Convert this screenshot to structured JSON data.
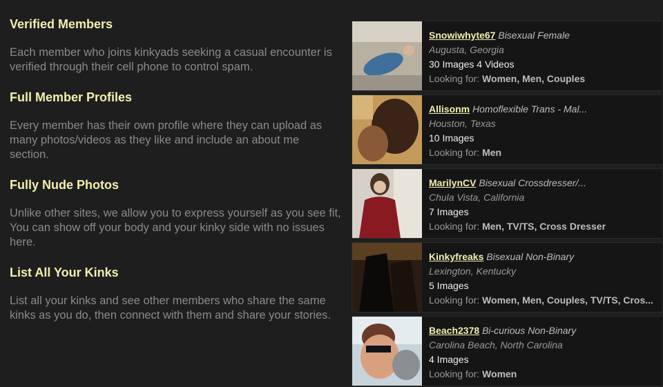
{
  "features": [
    {
      "title": "Verified Members",
      "text": "Each member who joins kinkyads seeking a casual encounter is verified through their cell phone to control spam."
    },
    {
      "title": "Full Member Profiles",
      "text": "Every member has their own profile where they can upload as many photos/videos as they like and include an about me section."
    },
    {
      "title": "Fully Nude Photos",
      "text": "Unlike other sites, we allow you to express yourself as you see fit, You can show off your body and your kinky side with no issues here."
    },
    {
      "title": "List All Your Kinks",
      "text": "List all your kinks and see other members who share the same kinks as you do, then connect with them and share your stories."
    }
  ],
  "members": [
    {
      "username": "Snowiwhyte67",
      "orientation": "Bisexual Female",
      "location": "Augusta, Georgia",
      "media": "30 Images 4 Videos",
      "looking_label": "Looking for:",
      "looking_for": "Women, Men, Couples"
    },
    {
      "username": "Allisonm",
      "orientation": "Homoflexible Trans - Mal...",
      "location": "Houston, Texas",
      "media": "10 Images",
      "looking_label": "Looking for:",
      "looking_for": "Men"
    },
    {
      "username": "MarilynCV",
      "orientation": "Bisexual Crossdresser/...",
      "location": "Chula Vista, California",
      "media": "7 Images",
      "looking_label": "Looking for:",
      "looking_for": "Men, TV/TS, Cross Dresser"
    },
    {
      "username": "Kinkyfreaks",
      "orientation": "Bisexual Non-Binary",
      "location": "Lexington, Kentucky",
      "media": "5 Images",
      "looking_label": "Looking for:",
      "looking_for": "Women, Men, Couples, TV/TS, Cros..."
    },
    {
      "username": "Beach2378",
      "orientation": "Bi-curious Non-Binary",
      "location": "Carolina Beach, North Carolina",
      "media": "4 Images",
      "looking_label": "Looking for:",
      "looking_for": "Women"
    }
  ],
  "colors": {
    "background": "#1e1e1e",
    "heading": "#f4eeb0",
    "body_text": "#8a8a8a",
    "card_bg": "#151515"
  }
}
